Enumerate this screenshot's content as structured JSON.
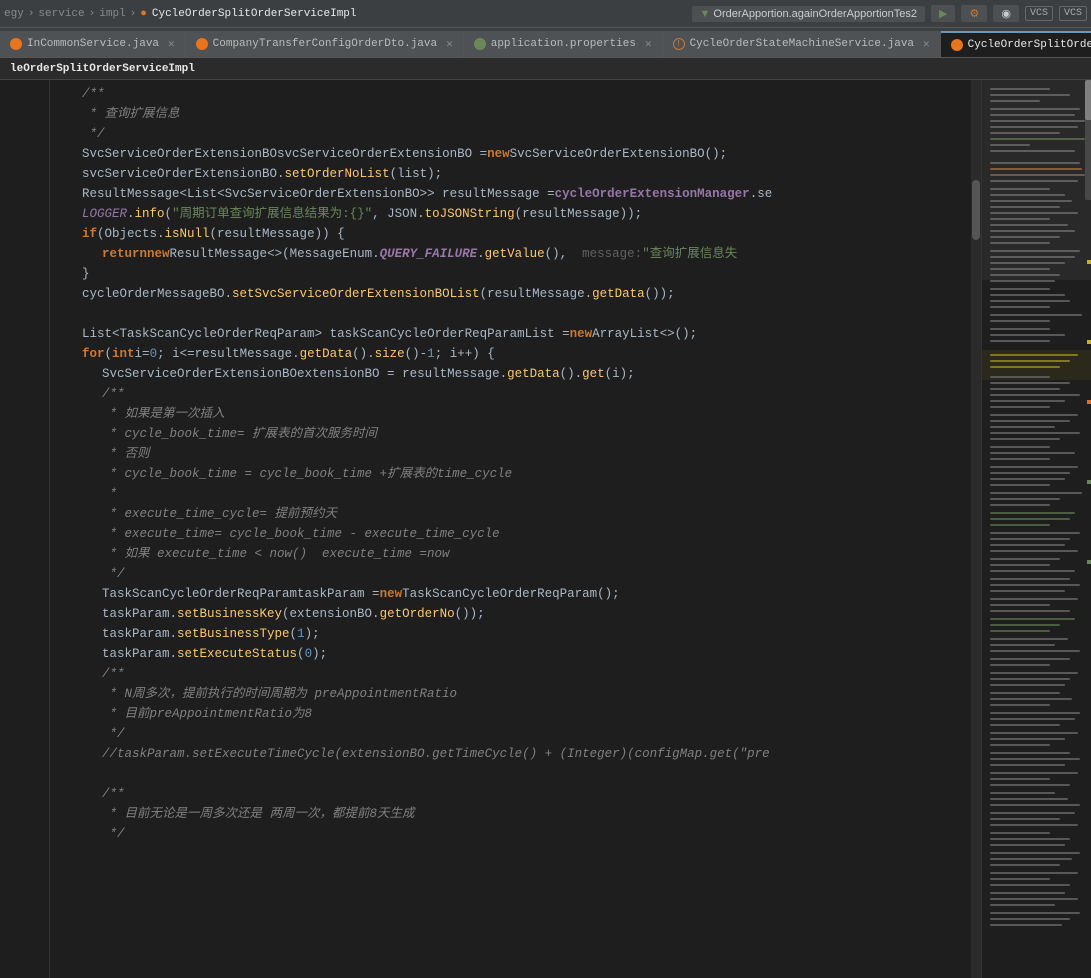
{
  "topBar": {
    "breadcrumb": [
      "egy",
      "service",
      "impl",
      "CycleOrderSplitOrderServiceImpl"
    ],
    "separators": [
      ">",
      ">",
      ">"
    ],
    "dropdownLabel": "OrderApportion.againOrderApportionTes2",
    "vcs1": "VCS",
    "vcs2": "VCS",
    "runIcon": "▶",
    "debugIcon": "⚙",
    "profileIcon": "◉"
  },
  "tabs": [
    {
      "id": "tab1",
      "label": "InCommonService.java",
      "type": "java",
      "active": false
    },
    {
      "id": "tab2",
      "label": "CompanyTransferConfigOrderDto.java",
      "type": "java",
      "active": false
    },
    {
      "id": "tab3",
      "label": "application.properties",
      "type": "properties",
      "active": false
    },
    {
      "id": "tab4",
      "label": "CycleOrderStateMachineService.java",
      "type": "java",
      "active": false
    },
    {
      "id": "tab5",
      "label": "CycleOrderSplitOrderServiceImpl.ja",
      "type": "java",
      "active": true
    }
  ],
  "activeTabLabel": "leOrderSplitOrderServiceImpl",
  "codeLines": [
    {
      "num": "",
      "content": "/**"
    },
    {
      "num": "",
      "content": " * 查询扩展信息"
    },
    {
      "num": "",
      "content": " */"
    },
    {
      "num": "",
      "content": "SvcServiceOrderExtensionBO svcServiceOrderExtensionBO = new SvcServiceOrderExtensionBO();"
    },
    {
      "num": "",
      "content": "svcServiceOrderExtensionBO.setOrderNoList(list);"
    },
    {
      "num": "",
      "content": "ResultMessage<List<SvcServiceOrderExtensionBO>> resultMessage = cycleOrderExtensionManager.se"
    },
    {
      "num": "",
      "content": "LOGGER.info(\"周期订单查询扩展信息结果为:{}\", JSON.toJSONString(resultMessage));"
    },
    {
      "num": "",
      "content": "if (Objects.isNull(resultMessage)) {"
    },
    {
      "num": "",
      "content": "    return new ResultMessage<>(MessageEnum.QUERY_FAILURE.getValue(),  message: \"查询扩展信息失"
    },
    {
      "num": "",
      "content": "}"
    },
    {
      "num": "",
      "content": "cycleOrderMessageBO.setSvcServiceOrderExtensionBOList(resultMessage.getData());"
    },
    {
      "num": "",
      "content": ""
    },
    {
      "num": "",
      "content": "List<TaskScanCycleOrderReqParam> taskScanCycleOrderReqParamList = new ArrayList<>();"
    },
    {
      "num": "",
      "content": "for (int i=0 ; i<=resultMessage.getData().size()-1; i++) {"
    },
    {
      "num": "",
      "content": "    SvcServiceOrderExtensionBO extensionBO = resultMessage.getData().get(i);"
    },
    {
      "num": "",
      "content": "    /**"
    },
    {
      "num": "",
      "content": "     * 如果是第一次插入"
    },
    {
      "num": "",
      "content": "     * cycle_book_time = 扩展表的首次服务时间"
    },
    {
      "num": "",
      "content": "     * 否则"
    },
    {
      "num": "",
      "content": "     * cycle_book_time = cycle_book_time + 扩展表的time_cycle"
    },
    {
      "num": "",
      "content": "     *"
    },
    {
      "num": "",
      "content": "     * execute_time_cycle = 提前预约天"
    },
    {
      "num": "",
      "content": "     * execute_time= cycle_book_time - execute_time_cycle"
    },
    {
      "num": "",
      "content": "     * 如果 execute_time < now()  execute_time =now"
    },
    {
      "num": "",
      "content": "     */"
    },
    {
      "num": "",
      "content": "    TaskScanCycleOrderReqParam taskParam = new TaskScanCycleOrderReqParam();"
    },
    {
      "num": "",
      "content": "    taskParam.setBusinessKey(extensionBO.getOrderNo());"
    },
    {
      "num": "",
      "content": "    taskParam.setBusinessType(1);"
    },
    {
      "num": "",
      "content": "    taskParam.setExecuteStatus(0);"
    },
    {
      "num": "",
      "content": "    /**"
    },
    {
      "num": "",
      "content": "     * N周多次，提前执行的时间周期为 preAppointmentRatio"
    },
    {
      "num": "",
      "content": "     * 目前preAppointmentRatio为8"
    },
    {
      "num": "",
      "content": "     */"
    },
    {
      "num": "",
      "content": "    //taskParam.setExecuteTimeCycle(extensionBO.getTimeCycle() + (Integer)(configMap.get(\"pre"
    },
    {
      "num": "",
      "content": ""
    },
    {
      "num": "",
      "content": "    /**"
    },
    {
      "num": "",
      "content": "     * 目前无论是一周多次还是 两周一次，都提前8天生成"
    },
    {
      "num": "",
      "content": "     */"
    }
  ]
}
